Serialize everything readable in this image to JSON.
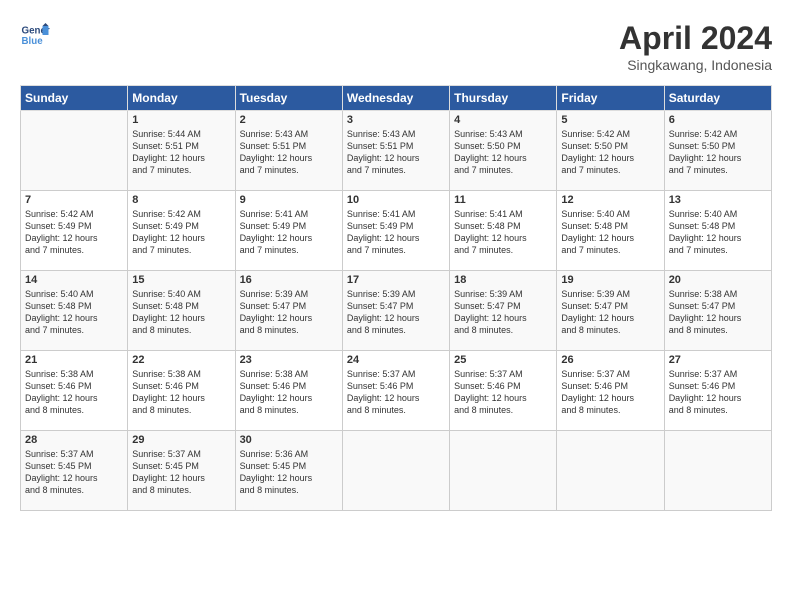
{
  "header": {
    "logo_line1": "General",
    "logo_line2": "Blue",
    "month_title": "April 2024",
    "location": "Singkawang, Indonesia"
  },
  "weekdays": [
    "Sunday",
    "Monday",
    "Tuesday",
    "Wednesday",
    "Thursday",
    "Friday",
    "Saturday"
  ],
  "weeks": [
    [
      {
        "day": "",
        "info": ""
      },
      {
        "day": "1",
        "info": "Sunrise: 5:44 AM\nSunset: 5:51 PM\nDaylight: 12 hours\nand 7 minutes."
      },
      {
        "day": "2",
        "info": "Sunrise: 5:43 AM\nSunset: 5:51 PM\nDaylight: 12 hours\nand 7 minutes."
      },
      {
        "day": "3",
        "info": "Sunrise: 5:43 AM\nSunset: 5:51 PM\nDaylight: 12 hours\nand 7 minutes."
      },
      {
        "day": "4",
        "info": "Sunrise: 5:43 AM\nSunset: 5:50 PM\nDaylight: 12 hours\nand 7 minutes."
      },
      {
        "day": "5",
        "info": "Sunrise: 5:42 AM\nSunset: 5:50 PM\nDaylight: 12 hours\nand 7 minutes."
      },
      {
        "day": "6",
        "info": "Sunrise: 5:42 AM\nSunset: 5:50 PM\nDaylight: 12 hours\nand 7 minutes."
      }
    ],
    [
      {
        "day": "7",
        "info": "Sunrise: 5:42 AM\nSunset: 5:49 PM\nDaylight: 12 hours\nand 7 minutes."
      },
      {
        "day": "8",
        "info": "Sunrise: 5:42 AM\nSunset: 5:49 PM\nDaylight: 12 hours\nand 7 minutes."
      },
      {
        "day": "9",
        "info": "Sunrise: 5:41 AM\nSunset: 5:49 PM\nDaylight: 12 hours\nand 7 minutes."
      },
      {
        "day": "10",
        "info": "Sunrise: 5:41 AM\nSunset: 5:49 PM\nDaylight: 12 hours\nand 7 minutes."
      },
      {
        "day": "11",
        "info": "Sunrise: 5:41 AM\nSunset: 5:48 PM\nDaylight: 12 hours\nand 7 minutes."
      },
      {
        "day": "12",
        "info": "Sunrise: 5:40 AM\nSunset: 5:48 PM\nDaylight: 12 hours\nand 7 minutes."
      },
      {
        "day": "13",
        "info": "Sunrise: 5:40 AM\nSunset: 5:48 PM\nDaylight: 12 hours\nand 7 minutes."
      }
    ],
    [
      {
        "day": "14",
        "info": "Sunrise: 5:40 AM\nSunset: 5:48 PM\nDaylight: 12 hours\nand 7 minutes."
      },
      {
        "day": "15",
        "info": "Sunrise: 5:40 AM\nSunset: 5:48 PM\nDaylight: 12 hours\nand 8 minutes."
      },
      {
        "day": "16",
        "info": "Sunrise: 5:39 AM\nSunset: 5:47 PM\nDaylight: 12 hours\nand 8 minutes."
      },
      {
        "day": "17",
        "info": "Sunrise: 5:39 AM\nSunset: 5:47 PM\nDaylight: 12 hours\nand 8 minutes."
      },
      {
        "day": "18",
        "info": "Sunrise: 5:39 AM\nSunset: 5:47 PM\nDaylight: 12 hours\nand 8 minutes."
      },
      {
        "day": "19",
        "info": "Sunrise: 5:39 AM\nSunset: 5:47 PM\nDaylight: 12 hours\nand 8 minutes."
      },
      {
        "day": "20",
        "info": "Sunrise: 5:38 AM\nSunset: 5:47 PM\nDaylight: 12 hours\nand 8 minutes."
      }
    ],
    [
      {
        "day": "21",
        "info": "Sunrise: 5:38 AM\nSunset: 5:46 PM\nDaylight: 12 hours\nand 8 minutes."
      },
      {
        "day": "22",
        "info": "Sunrise: 5:38 AM\nSunset: 5:46 PM\nDaylight: 12 hours\nand 8 minutes."
      },
      {
        "day": "23",
        "info": "Sunrise: 5:38 AM\nSunset: 5:46 PM\nDaylight: 12 hours\nand 8 minutes."
      },
      {
        "day": "24",
        "info": "Sunrise: 5:37 AM\nSunset: 5:46 PM\nDaylight: 12 hours\nand 8 minutes."
      },
      {
        "day": "25",
        "info": "Sunrise: 5:37 AM\nSunset: 5:46 PM\nDaylight: 12 hours\nand 8 minutes."
      },
      {
        "day": "26",
        "info": "Sunrise: 5:37 AM\nSunset: 5:46 PM\nDaylight: 12 hours\nand 8 minutes."
      },
      {
        "day": "27",
        "info": "Sunrise: 5:37 AM\nSunset: 5:46 PM\nDaylight: 12 hours\nand 8 minutes."
      }
    ],
    [
      {
        "day": "28",
        "info": "Sunrise: 5:37 AM\nSunset: 5:45 PM\nDaylight: 12 hours\nand 8 minutes."
      },
      {
        "day": "29",
        "info": "Sunrise: 5:37 AM\nSunset: 5:45 PM\nDaylight: 12 hours\nand 8 minutes."
      },
      {
        "day": "30",
        "info": "Sunrise: 5:36 AM\nSunset: 5:45 PM\nDaylight: 12 hours\nand 8 minutes."
      },
      {
        "day": "",
        "info": ""
      },
      {
        "day": "",
        "info": ""
      },
      {
        "day": "",
        "info": ""
      },
      {
        "day": "",
        "info": ""
      }
    ]
  ]
}
